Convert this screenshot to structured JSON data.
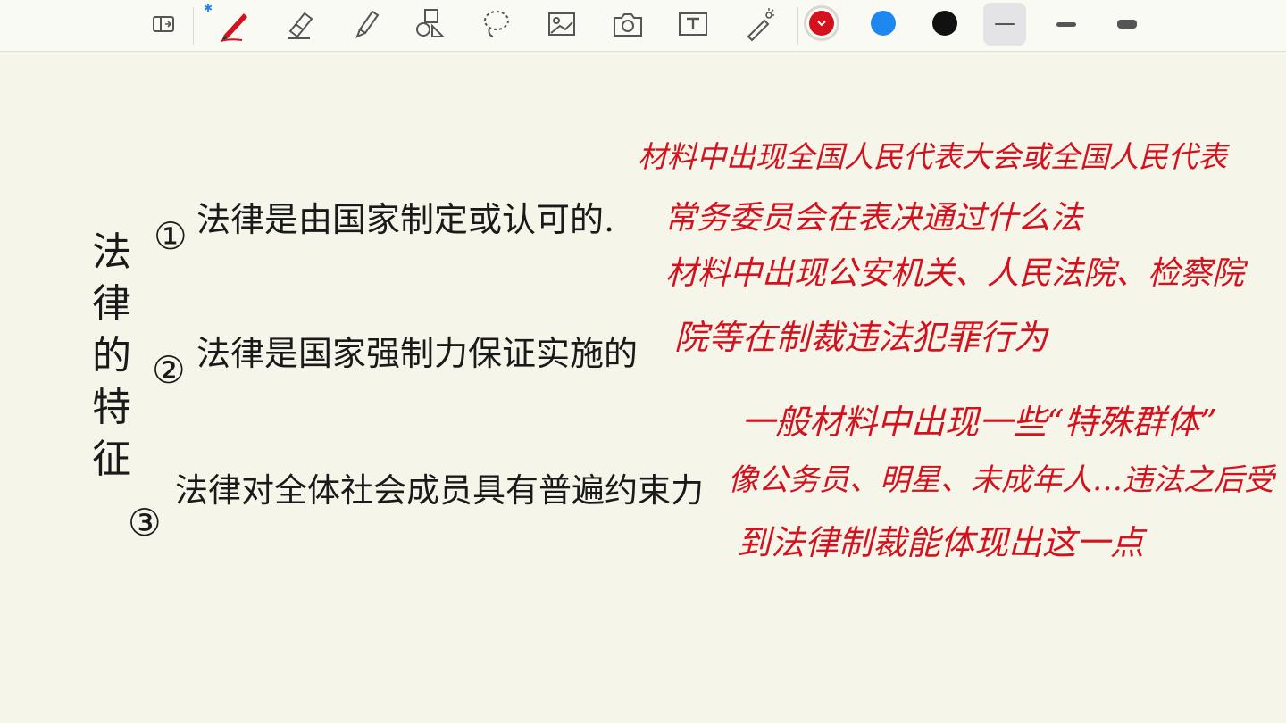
{
  "toolbar": {
    "tools": [
      {
        "name": "sidebar-toggle-icon"
      },
      {
        "name": "pen-icon"
      },
      {
        "name": "eraser-icon"
      },
      {
        "name": "highlighter-icon"
      },
      {
        "name": "shapes-icon"
      },
      {
        "name": "lasso-icon"
      },
      {
        "name": "image-icon"
      },
      {
        "name": "camera-icon"
      },
      {
        "name": "text-box-icon"
      },
      {
        "name": "laser-pointer-icon"
      }
    ],
    "bluetooth_icon": "bluetooth-icon",
    "colors": [
      {
        "name": "red",
        "hex": "#d4121e",
        "selected": true
      },
      {
        "name": "blue",
        "hex": "#1e88f0",
        "selected": false
      },
      {
        "name": "black",
        "hex": "#111111",
        "selected": false
      }
    ],
    "stroke_widths": [
      {
        "label": "thin",
        "selected": true
      },
      {
        "label": "medium",
        "selected": false
      },
      {
        "label": "thick",
        "selected": false
      }
    ]
  },
  "note": {
    "title_chars": [
      "法",
      "律",
      "的",
      "特",
      "征"
    ],
    "points": [
      {
        "marker": "①",
        "text": "法律是由国家制定或认可的."
      },
      {
        "marker": "②",
        "text": "法律是国家强制力保证实施的"
      },
      {
        "marker": "③",
        "text": "法律对全体社会成员具有普遍约束力"
      }
    ],
    "annotations": [
      {
        "lines": [
          "材料中出现全国人民代表大会或全国人民代表",
          "常务委员会在表决通过什么法"
        ]
      },
      {
        "lines": [
          "材料中出现公安机关、人民法院、检察院",
          "院等在制裁违法犯罪行为"
        ]
      },
      {
        "lines": [
          "一般材料中出现一些“特殊群体”",
          "像公务员、明星、未成年人…违法之后受",
          "到法律制裁能体现出这一点"
        ]
      }
    ]
  }
}
